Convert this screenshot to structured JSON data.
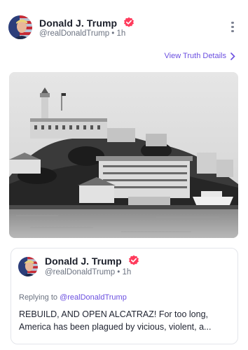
{
  "post": {
    "author_name": "Donald J. Trump",
    "handle": "@realDonaldTrump",
    "separator": "•",
    "time": "1h",
    "details_link": "View Truth Details",
    "more_icon": "more-vertical-icon",
    "verified_icon": "verified-badge-icon",
    "image_subject": "Alcatraz Island black-and-white photograph"
  },
  "quote": {
    "author_name": "Donald J. Trump",
    "handle": "@realDonaldTrump",
    "separator": "•",
    "time": "1h",
    "replying_prefix": "Replying to",
    "replying_handle": "@realDonaldTrump",
    "text_line1": "REBUILD, AND OPEN ALCATRAZ! For too long,",
    "text_line2": "America has been plagued by vicious, violent, a..."
  },
  "colors": {
    "accent": "#6b4fe0",
    "verified": "#ff3b5c",
    "muted": "#6b7280"
  }
}
